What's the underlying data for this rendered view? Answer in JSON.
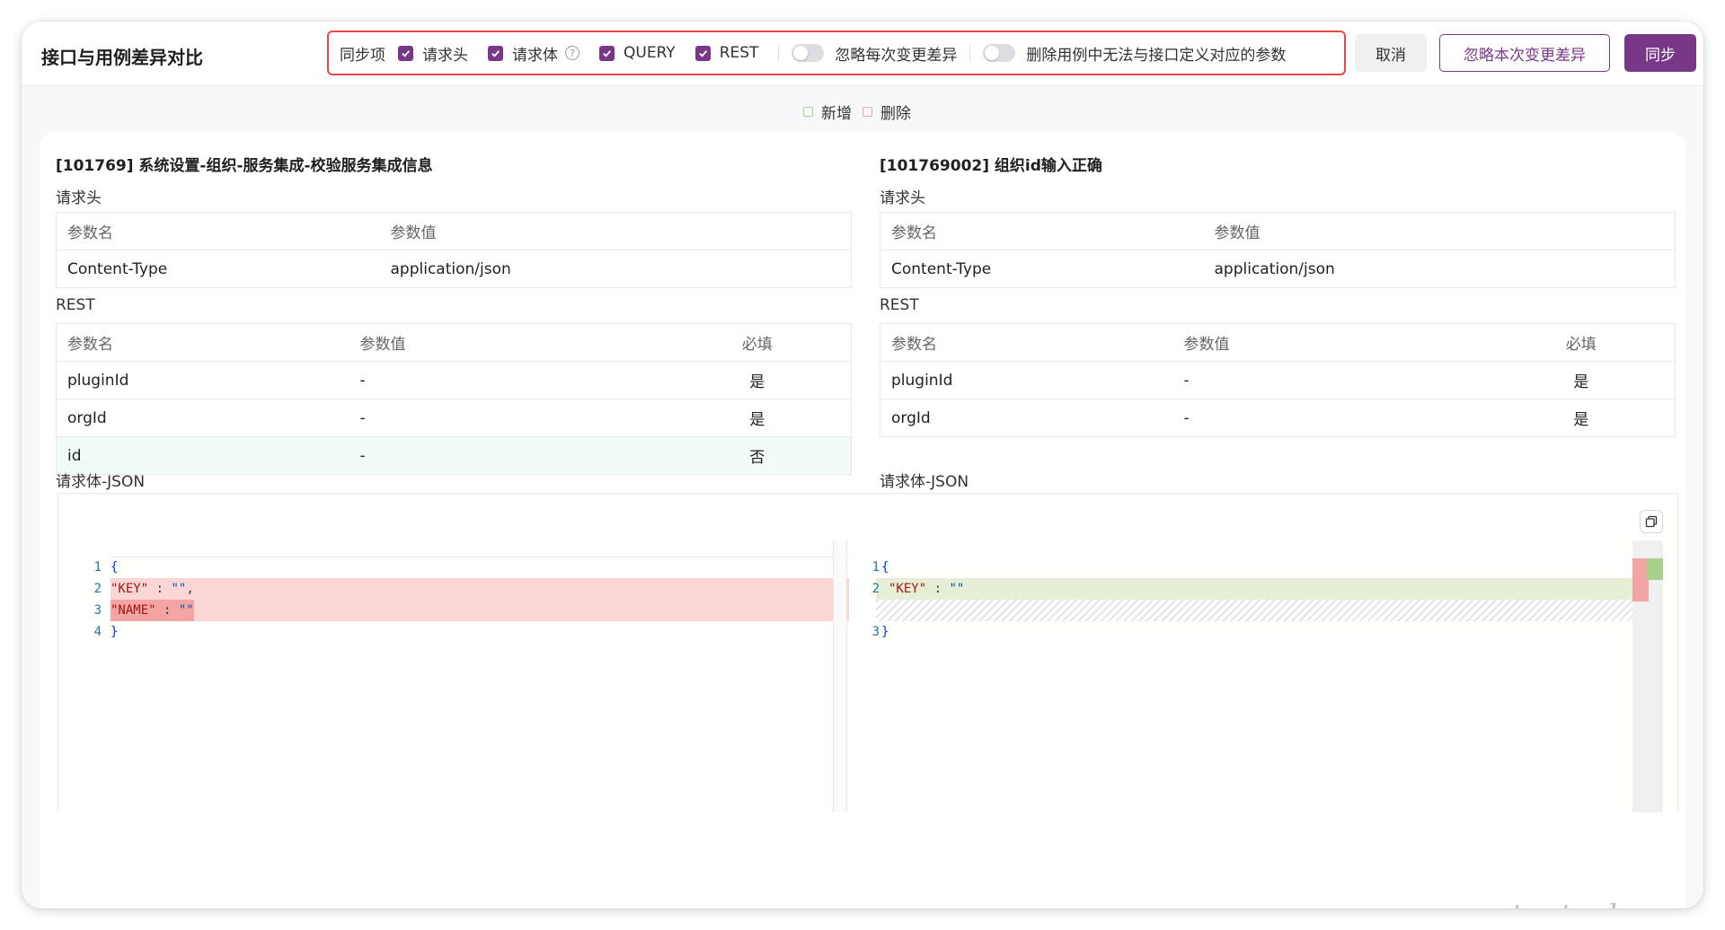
{
  "header": {
    "title": "接口与用例差异对比",
    "sync_label": "同步项",
    "options": [
      {
        "label": "请求头",
        "checked": true
      },
      {
        "label": "请求体",
        "checked": true,
        "help": true
      },
      {
        "label": "QUERY",
        "checked": true
      },
      {
        "label": "REST",
        "checked": true
      }
    ],
    "toggle_ignore_each": "忽略每次变更差异",
    "toggle_delete_params": "删除用例中无法与接口定义对应的参数",
    "cancel_button": "取消",
    "ignore_button": "忽略本次变更差异",
    "sync_button": "同步"
  },
  "legend": {
    "added": "新增",
    "deleted": "删除",
    "added_color": "#a7d18a",
    "deleted_color": "#f4a4a3"
  },
  "left": {
    "title": "[101769] 系统设置-组织-服务集成-校验服务集成信息",
    "headers_section": "请求头",
    "headers_cols": [
      "参数名",
      "参数值"
    ],
    "headers_rows": [
      [
        "Content-Type",
        "application/json"
      ]
    ],
    "rest_section": "REST",
    "rest_cols": [
      "参数名",
      "参数值",
      "必填"
    ],
    "rest_rows": [
      [
        "pluginId",
        "-",
        "是"
      ],
      [
        "orgId",
        "-",
        "是"
      ],
      [
        "id",
        "-",
        "否"
      ]
    ],
    "body_section": "请求体-JSON",
    "code": {
      "l1": "{",
      "l2k": "\"KEY\"",
      "l2v": "\"\"",
      "l3k": "\"NAME\"",
      "l3v": "\"\"",
      "l4": "}"
    }
  },
  "right": {
    "title": "[101769002] 组织id输入正确",
    "headers_section": "请求头",
    "headers_cols": [
      "参数名",
      "参数值"
    ],
    "headers_rows": [
      [
        "Content-Type",
        "application/json"
      ]
    ],
    "rest_section": "REST",
    "rest_cols": [
      "参数名",
      "参数值",
      "必填"
    ],
    "rest_rows": [
      [
        "pluginId",
        "-",
        "是"
      ],
      [
        "orgId",
        "-",
        "是"
      ]
    ],
    "body_section": "请求体-JSON",
    "code": {
      "l1": "{",
      "l2k": "\"KEY\"",
      "l2v": "\"\"",
      "l3": "}"
    }
  },
  "watermark": "testerhome.com",
  "brand_color": "#783887"
}
